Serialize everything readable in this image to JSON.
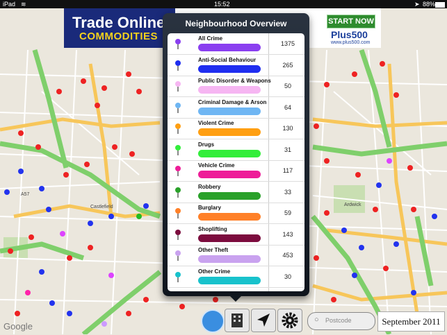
{
  "status": {
    "carrier": "iPad",
    "time": "15:52",
    "battery": "88%"
  },
  "ad": {
    "title": "Trade Online",
    "subtitle": "COMMODITIES",
    "cta": "START NOW",
    "brand": "Plus500",
    "url": "www.plus500.com"
  },
  "popover": {
    "title": "Neighbourhood Overview",
    "rows": [
      {
        "label": "All Crime",
        "count": "1375",
        "color": "#8a3ff0"
      },
      {
        "label": "Anti-Social Behaviour",
        "count": "265",
        "color": "#1f2ef0"
      },
      {
        "label": "Public Disorder & Weapons",
        "count": "50",
        "color": "#f6b6f2"
      },
      {
        "label": "Criminal Damage & Arson",
        "count": "64",
        "color": "#6fb6f3"
      },
      {
        "label": "Violent Crime",
        "count": "130",
        "color": "#ff9f12"
      },
      {
        "label": "Drugs",
        "count": "31",
        "color": "#33ee3b"
      },
      {
        "label": "Vehicle Crime",
        "count": "117",
        "color": "#ee1d98"
      },
      {
        "label": "Robbery",
        "count": "33",
        "color": "#2aa12a"
      },
      {
        "label": "Burglary",
        "count": "59",
        "color": "#ff8028"
      },
      {
        "label": "Shoplifting",
        "count": "143",
        "color": "#7c0c3e"
      },
      {
        "label": "Other Theft",
        "count": "453",
        "color": "#c9a2ef"
      },
      {
        "label": "Other Crime",
        "count": "30",
        "color": "#18c2cc"
      }
    ]
  },
  "toolbar": {
    "search_placeholder": "Postcode",
    "date": "September 2011"
  },
  "map": {
    "attribution": "Google"
  }
}
